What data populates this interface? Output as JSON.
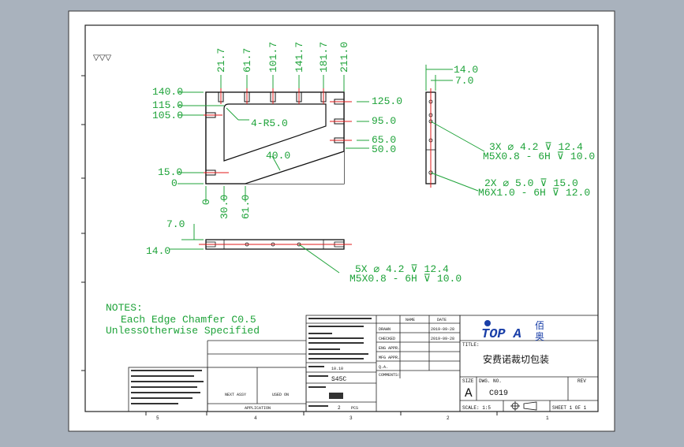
{
  "surface_symbol": "▽▽▽",
  "views": {
    "top": {
      "x_dims": [
        "21.7",
        "61.7",
        "101.7",
        "141.7",
        "181.7",
        "211.0"
      ],
      "left_dims": [
        "140.0",
        "115.0",
        "105.0",
        "15.0",
        "0"
      ],
      "right_dims": [
        "125.0",
        "95.0",
        "65.0",
        "50.0"
      ],
      "bottom_dims": [
        "0",
        "30.0",
        "61.0"
      ],
      "radius_note": "4-R5.0",
      "angle_note": "40.0"
    },
    "side": {
      "top_dims": [
        "14.0",
        "7.0"
      ],
      "hole_note_1": [
        "3X ⌀ 4.2 ⊽ 12.4",
        "M5X0.8 - 6H ⊽ 10.0"
      ],
      "hole_note_2": [
        "2X ⌀ 5.0 ⊽ 15.0",
        "M6X1.0 - 6H ⊽ 12.0"
      ]
    },
    "bottom": {
      "dims": [
        "7.0",
        "14.0"
      ],
      "hole_note": [
        "5X ⌀ 4.2 ⊽ 12.4",
        "M5X0.8 - 6H ⊽ 10.0"
      ]
    }
  },
  "notes": {
    "heading": "NOTES:",
    "lines": [
      "Each Edge Chamfer C0.5",
      "UnlessOtherwise Specified"
    ]
  },
  "title_block": {
    "company_logo_text": "TOP A",
    "company_cn": "佰奥",
    "title_label": "TITLE:",
    "title": "安费诺裁切包装",
    "size_label": "SIZE",
    "size_value": "A",
    "dwg_label": "DWG. NO.",
    "dwg_value": "C019",
    "rev_label": "REV",
    "scale": "SCALE: 1:5",
    "sheet": "SHEET 1 OF 1",
    "name_label": "NAME",
    "date_label": "DATE",
    "drawn_label": "DRAWN",
    "checked_label": "CHECKED",
    "eng_label": "ENG APPR.",
    "mfg_label": "MFG APPR.",
    "qa_label": "Q.A.",
    "comments_label": "COMMENTS:",
    "material": "S45C",
    "finish": "10.10",
    "date1": "2019-09-28",
    "date2": "2019-09-28",
    "next_assy": "NEXT ASSY",
    "used_on": "USED ON",
    "application": "APPLICATION",
    "weight": "2",
    "pcs": "PCS"
  },
  "zones_bottom": [
    "5",
    "4",
    "3",
    "2",
    "1"
  ]
}
